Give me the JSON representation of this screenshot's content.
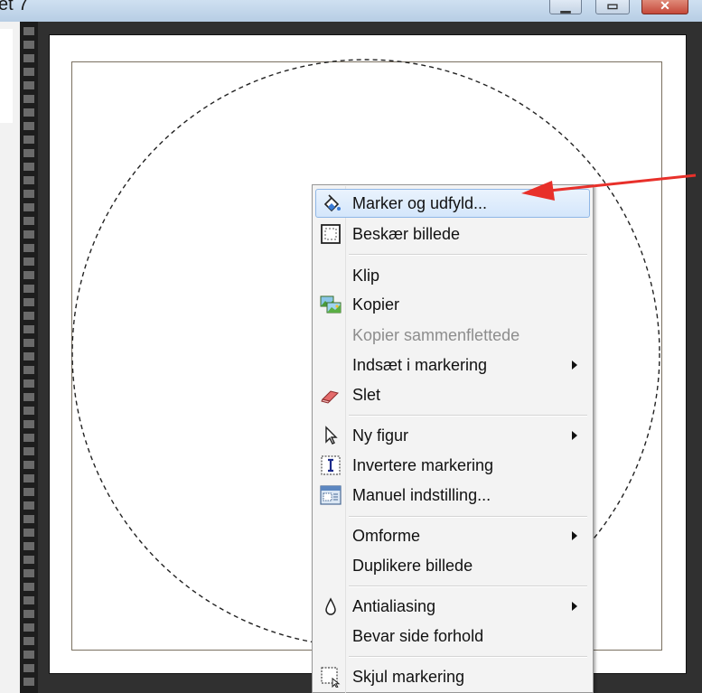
{
  "window": {
    "title": "et 7",
    "minimize_icon": "minimize-icon",
    "maximize_icon": "maximize-icon",
    "close_icon": "close-icon"
  },
  "canvas": {
    "selection_shape": "dashed-circle"
  },
  "context_menu": {
    "items": [
      {
        "label": "Marker og udfyld...",
        "icon": "paint-bucket-icon",
        "highlighted": true
      },
      {
        "label": "Beskær billede",
        "icon": "crop-icon"
      },
      {
        "label": "Klip"
      },
      {
        "label": "Kopier",
        "icon": "copy-image-icon"
      },
      {
        "label": "Kopier sammenflettede",
        "disabled": true
      },
      {
        "label": "Indsæt i markering",
        "submenu": true
      },
      {
        "label": "Slet",
        "icon": "eraser-icon"
      },
      {
        "label": "Ny figur",
        "icon": "pointer-icon",
        "submenu": true
      },
      {
        "label": "Invertere markering",
        "icon": "invert-selection-icon"
      },
      {
        "label": "Manuel indstilling...",
        "icon": "manual-settings-icon"
      },
      {
        "label": "Omforme",
        "submenu": true
      },
      {
        "label": "Duplikere billede"
      },
      {
        "label": "Antialiasing",
        "icon": "droplet-icon",
        "submenu": true
      },
      {
        "label": "Bevar side forhold"
      },
      {
        "label": "Skjul markering",
        "icon": "hide-selection-icon"
      }
    ]
  },
  "annotation": {
    "arrow_color": "#e8302a"
  }
}
